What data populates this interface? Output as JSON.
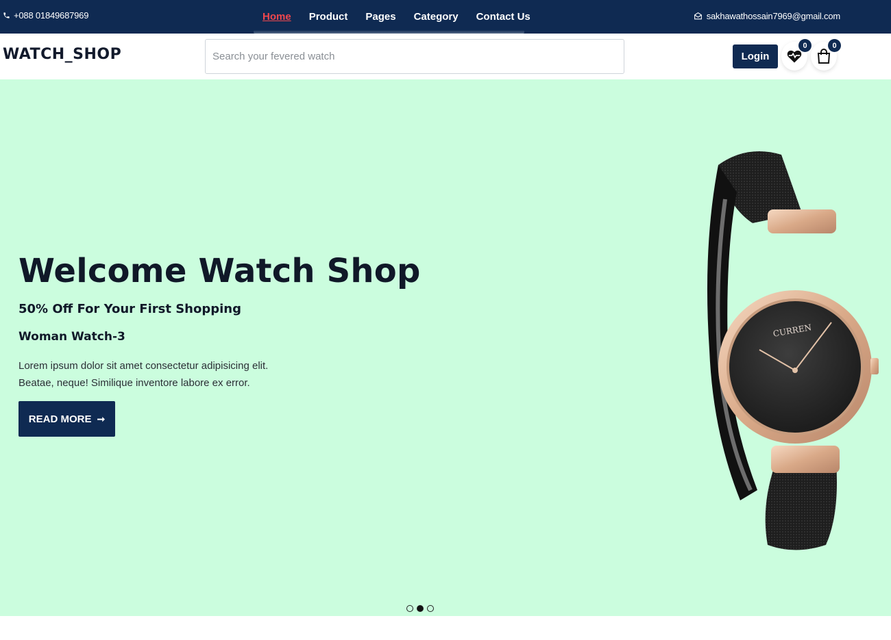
{
  "topbar": {
    "phone": "+088 01849687969",
    "email": "sakhawathossain7969@gmail.com",
    "nav": [
      "Home",
      "Product",
      "Pages",
      "Category",
      "Contact Us"
    ],
    "active_nav": "Home",
    "phone_icon": "phone-icon",
    "email_icon": "envelope-icon"
  },
  "header": {
    "logo": "WATCH_SHOP",
    "search_placeholder": "Search your fevered watch",
    "login_label": "Login",
    "wishlist_count": "0",
    "cart_count": "0",
    "wishlist_icon": "heart-pulse-icon",
    "cart_icon": "shopping-bag-icon"
  },
  "hero": {
    "title": "Welcome Watch Shop",
    "offer": "50% Off For Your First Shopping",
    "model": "Woman Watch-3",
    "description": "Lorem ipsum dolor sit amet consectetur adipisicing elit. Beatae, neque! Similique inventore labore ex error.",
    "button_label": "READ MORE",
    "watch_brand": "CURREN",
    "slide_count": 3,
    "active_slide": 2
  },
  "colors": {
    "navy": "#0f2a52",
    "active_link": "#f0474d",
    "hero_bg": "#cbfdde"
  }
}
